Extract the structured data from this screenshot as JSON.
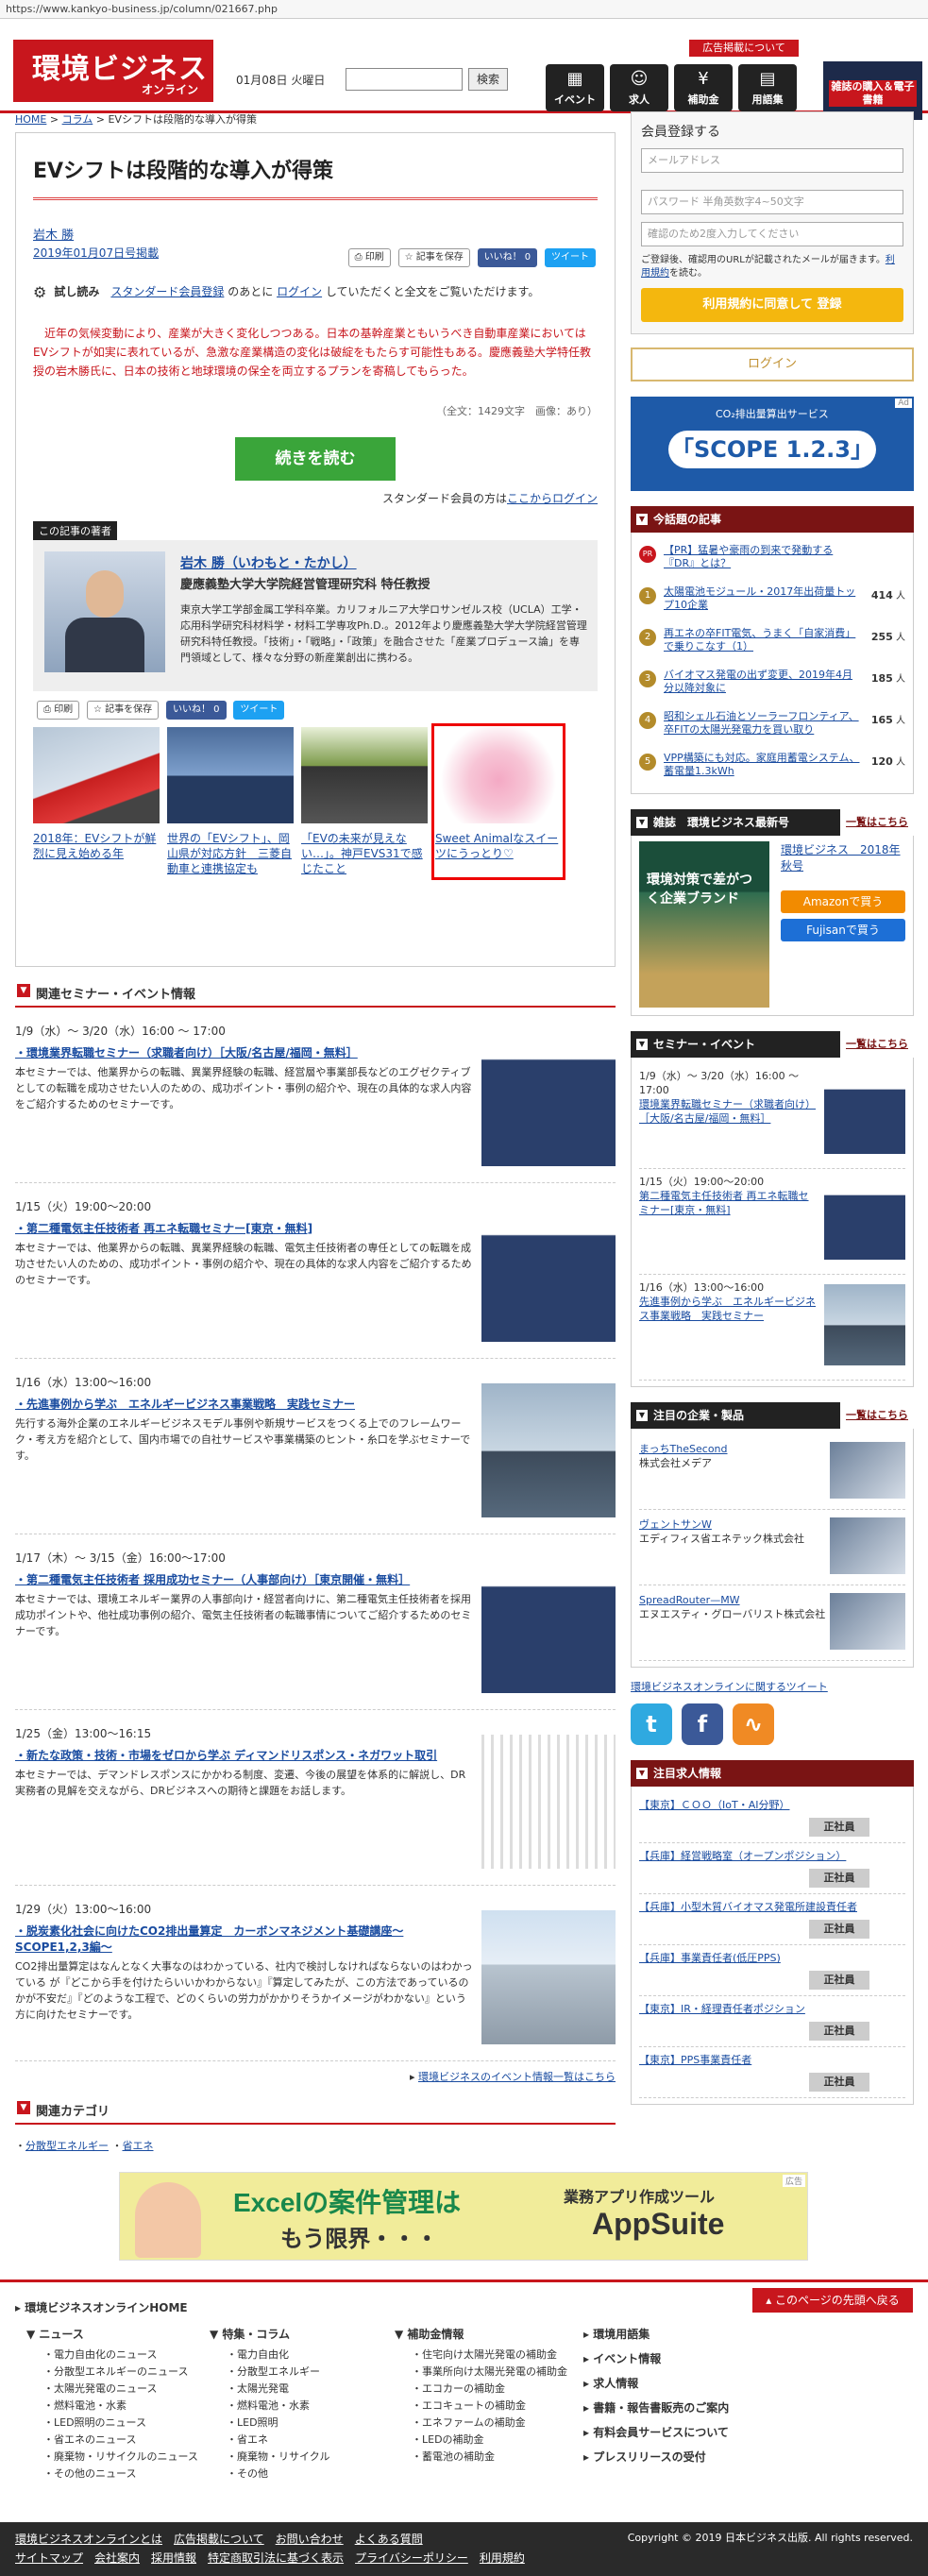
{
  "url": "https://www.kankyo-business.jp/column/021667.php",
  "header": {
    "logo_main": "環境ビジネス",
    "logo_sub": "オンライン",
    "date": "01月08日 火曜日",
    "search_button": "検索",
    "ad_info": "広告掲載について",
    "nav": [
      {
        "label": "イベント",
        "icon": "calendar-icon",
        "glyph": "▦"
      },
      {
        "label": "求人",
        "icon": "person-icon",
        "glyph": "☺"
      },
      {
        "label": "補助金",
        "icon": "yen-icon",
        "glyph": "¥"
      },
      {
        "label": "用語集",
        "icon": "book-icon",
        "glyph": "▤"
      }
    ],
    "banner_text": "雑誌の購入＆電子書籍"
  },
  "breadcrumb": {
    "home": "HOME",
    "column": "コラム",
    "current": "EVシフトは段階的な導入が得策"
  },
  "article": {
    "title": "EVシフトは段階的な導入が得策",
    "author": "岩木 勝",
    "date": "2019年01月07日号掲載",
    "print": "印刷",
    "save": "記事を保存",
    "like": "いいね！ 0",
    "tweet": "ツイート",
    "trial_label": "試し読み",
    "trial_link1": "スタンダード会員登録",
    "trial_mid": "のあとに",
    "trial_link2": "ログイン",
    "trial_tail": "していただくと全文をご覧いただけます。",
    "lead": "近年の気候変動により、産業が大きく変化しつつある。日本の基幹産業ともいうべき自動車産業においてはEVシフトが如実に表れているが、急激な産業構造の変化は破綻をもたらす可能性もある。慶應義塾大学特任教授の岩木勝氏に、日本の技術と地球環境の保全を両立するプランを寄稿してもらった。",
    "count": "（全文：1429文字　画像：あり）",
    "read_more": "続きを読む",
    "std_login_pre": "スタンダード会員の方は",
    "std_login_link": "ここからログイン"
  },
  "author_box": {
    "title": "この記事の著者",
    "name": "岩木 勝（いわもと・たかし）",
    "affiliation": "慶應義塾大学大学院経営管理研究科 特任教授",
    "bio": "東京大学工学部金属工学科卒業。カリフォルニア大学ロサンゼルス校（UCLA）工学・応用科学研究科材料学・材料工学専攻Ph.D.。2012年より慶應義塾大学大学院経営管理研究科特任教授。「技術」・「戦略」・「政策」を融合させた「産業プロデュース論」を専門領域として、様々な分野の新産業創出に携わる。"
  },
  "related": [
    {
      "text": "2018年：EVシフトが鮮烈に見え始める年",
      "thumb": "th-car"
    },
    {
      "text": "世界の「EVシフト」、岡山県が対応方針　三菱自動車と連携協定も",
      "thumb": "th-man"
    },
    {
      "text": "「EVの未来が見えない…」。神戸EVS31で感じたこと",
      "thumb": "th-expo"
    },
    {
      "text": "Sweet Animalなスイーツにうっとり♡",
      "thumb": "th-cake"
    }
  ],
  "seminars_section": {
    "title": "関連セミナー・イベント情報",
    "items": [
      {
        "date": "1/9（水）～ 3/20（水）16:00 ～ 17:00",
        "title": "環境業界転職セミナー（求職者向け）［大阪/名古屋/福岡・無料］",
        "text": "本セミナーでは、他業界からの転職、異業界経験の転職、経営層や事業部長などのエグゼクティブとしての転職を成功させたい人のための、成功ポイント・事例の紹介や、現在の具体的な求人内容をご紹介するためのセミナーです。",
        "thumb": "th-sem"
      },
      {
        "date": "1/15（火）19:00～20:00",
        "title": "第二種電気主任技術者 再エネ転職セミナー[東京・無料]",
        "text": "本セミナーでは、他業界からの転職、異業界経験の転職、電気主任技術者の専任としての転職を成功させたい人のための、成功ポイント・事例の紹介や、現在の具体的な求人内容をご紹介するためのセミナーです。",
        "thumb": "th-sem"
      },
      {
        "date": "1/16（水）13:00～16:00",
        "title": "先進事例から学ぶ　エネルギービジネス事業戦略　実践セミナー",
        "text": "先行する海外企業のエネルギービジネスモデル事例や新規サービスをつくる上でのフレームワーク・考え方を紹介として、国内市場での自社サービスや事業構築のヒント・糸口を学ぶセミナーです。",
        "thumb": "th-city"
      },
      {
        "date": "1/17（木）～ 3/15（金）16:00～17:00",
        "title": "第二種電気主任技術者 採用成功セミナー（人事部向け）［東京開催・無料］",
        "text": "本セミナーでは、環境エネルギー業界の人事部向け・経営者向けに、第二種電気主任技術者を採用成功ポイントや、他社成功事例の紹介、電気主任技術者の転職事情についてご紹介するためのセミナーです。",
        "thumb": "th-sem"
      },
      {
        "date": "1/25（金）13:00～16:15",
        "title": "新たな政策・技術・市場をゼロから学ぶ ディマンドリスポンス・ネガワット取引",
        "text": "本セミナーでは、デマンドレスポンスにかかわる制度、変遷、今後の展望を体系的に解説し、DR実務者の見解を交えながら、DRビジネスへの期待と課題をお話します。",
        "thumb": "th-chart"
      },
      {
        "date": "1/29（火）13:00～16:00",
        "title": "脱炭素化社会に向けたCO2排出量算定　カーボンマネジメント基礎講座～SCOPE1,2,3編～",
        "text": "CO2排出量算定はなんとなく大事なのはわかっている、社内で検討しなければならないのはわかっている が『どこから手を付けたらいいかわからない』『算定してみたが、この方法であっているのかが不安だ』『どのような工程で、どのくらいの労力がかかりそうかイメージがわかない』という方に向けたセミナーです。",
        "thumb": "th-build"
      }
    ],
    "more": "環境ビジネスのイベント情報一覧はこちら"
  },
  "categories": {
    "title": "関連カテゴリ",
    "items": [
      "分散型エネルギー",
      "省エネ"
    ]
  },
  "register": {
    "title": "会員登録する",
    "mail_placeholder": "メールアドレス",
    "pass_placeholder": "パスワード 半角英数字4~50文字",
    "pass2_placeholder": "確認のため2度入力してください",
    "note_pre": "ご登録後、確認用のURLが記載されたメールが届きます。",
    "note_link": "利用規約",
    "note_tail": "を読む。",
    "register_button": "利用規約に同意して 登録",
    "login_button": "ログイン"
  },
  "side_ad": {
    "text1": "CO₂排出量算出サービス",
    "text2": "「SCOPE 1.2.3」",
    "tag": "Ad"
  },
  "ranking": {
    "title": "今話題の記事",
    "more": "",
    "pr_text": "【PR】猛暑や豪雨の到来で発動する『DR』とは？",
    "pr_badge": "PR",
    "items": [
      {
        "rank": "1",
        "text": "太陽電池モジュール・2017年出荷量トップ10企業",
        "count": "414"
      },
      {
        "rank": "2",
        "text": "再エネの卒FIT電気、うまく「自家消費」で乗りこなす（1）",
        "count": "255"
      },
      {
        "rank": "3",
        "text": "バイオマス発電の出ず変更、2019年4月分以降対象に",
        "count": "185"
      },
      {
        "rank": "4",
        "text": "昭和シェル石油とソーラーフロンティア、卒FITの太陽光発電力を買い取り",
        "count": "165"
      },
      {
        "rank": "5",
        "text": "VPP構築にも対応。家庭用蓄電システム、蓄電量1.3kWh",
        "count": "120"
      }
    ]
  },
  "magazine": {
    "title": "雑誌　環境ビジネス最新号",
    "more": "一覧はこちら",
    "name": "環境ビジネス　2018年秋号",
    "cover_text": "環境対策で差がつく企業ブランド",
    "amazon": "Amazonで買う",
    "fujisan": "Fujisanで買う"
  },
  "side_seminars": {
    "title": "セミナー・イベント",
    "more": "一覧はこちら",
    "items": [
      {
        "date": "1/9（水）～ 3/20（水）16:00 ～ 17:00",
        "title": "環境業界転職セミナー（求職者向け）［大阪/名古屋/福岡・無料］",
        "thumb": "th-sem"
      },
      {
        "date": "1/15（火）19:00～20:00",
        "title": "第二種電気主任技術者 再エネ転職セミナー[東京・無料]",
        "thumb": "th-sem"
      },
      {
        "date": "1/16（水）13:00～16:00",
        "title": "先進事例から学ぶ　エネルギービジネス事業戦略　実践セミナー",
        "thumb": "th-city"
      }
    ]
  },
  "products": {
    "title": "注目の企業・製品",
    "more": "一覧はこちら",
    "items": [
      {
        "name": "まっちTheSecond",
        "company": "株式会社メデア"
      },
      {
        "name": "ヴェントサンW",
        "company": "エディフィス省エネテック株式会社"
      },
      {
        "name": "SpreadRouter—MW",
        "company": "エヌエスティ・グローバリスト株式会社"
      }
    ],
    "tweet_link": "環境ビジネスオンラインに関するツイート"
  },
  "jobs": {
    "title": "注目求人情報",
    "tag": "正社員",
    "items": [
      "【東京】ＣＯＯ（IoT・AI分野）",
      "【兵庫】経営戦略室（オープンポジション）",
      "【兵庫】小型木質バイオマス発電所建設責任者",
      "【兵庫】事業責任者(低圧PPS)",
      "【東京】IR・経理責任者ポジション",
      "【東京】PPS事業責任者"
    ]
  },
  "bottom_ad": {
    "line1_a": "Excel",
    "line1_b": "の案件管理は",
    "line2": "もう限界・・・",
    "line3": "業務アプリ作成ツール",
    "line4": "AppSuite",
    "tag": "広告"
  },
  "footer": {
    "home": "環境ビジネスオンラインHOME",
    "back_to_top": "このページの先頭へ戻る",
    "news_title": "ニュース",
    "news": [
      "電力自由化のニュース",
      "分散型エネルギーのニュース",
      "太陽光発電のニュース",
      "燃料電池・水素",
      "LED照明のニュース",
      "省エネのニュース",
      "廃棄物・リサイクルのニュース",
      "その他のニュース"
    ],
    "column_title": "特集・コラム",
    "column": [
      "電力自由化",
      "分散型エネルギー",
      "太陽光発電",
      "燃料電池・水素",
      "LED照明",
      "省エネ",
      "廃棄物・リサイクル",
      "その他"
    ],
    "subsidy_title": "補助金情報",
    "subsidy": [
      "住宅向け太陽光発電の補助金",
      "事業所向け太陽光発電の補助金",
      "エコカーの補助金",
      "エコキュートの補助金",
      "エネファームの補助金",
      "LEDの補助金",
      "蓄電池の補助金"
    ],
    "col4": [
      "環境用語集",
      "イベント情報",
      "求人情報",
      "書籍・報告書販売のご案内",
      "有料会員サービスについて",
      "プレスリリースの受付"
    ],
    "links_row1": [
      "環境ビジネスオンラインとは",
      "広告掲載について",
      "お問い合わせ",
      "よくある質問"
    ],
    "links_row2": [
      "サイトマップ",
      "会社案内",
      "採用情報",
      "特定商取引法に基づく表示",
      "プライバシーポリシー",
      "利用規約"
    ],
    "copyright": "Copyright © 2019 日本ビジネス出版. All rights reserved."
  }
}
